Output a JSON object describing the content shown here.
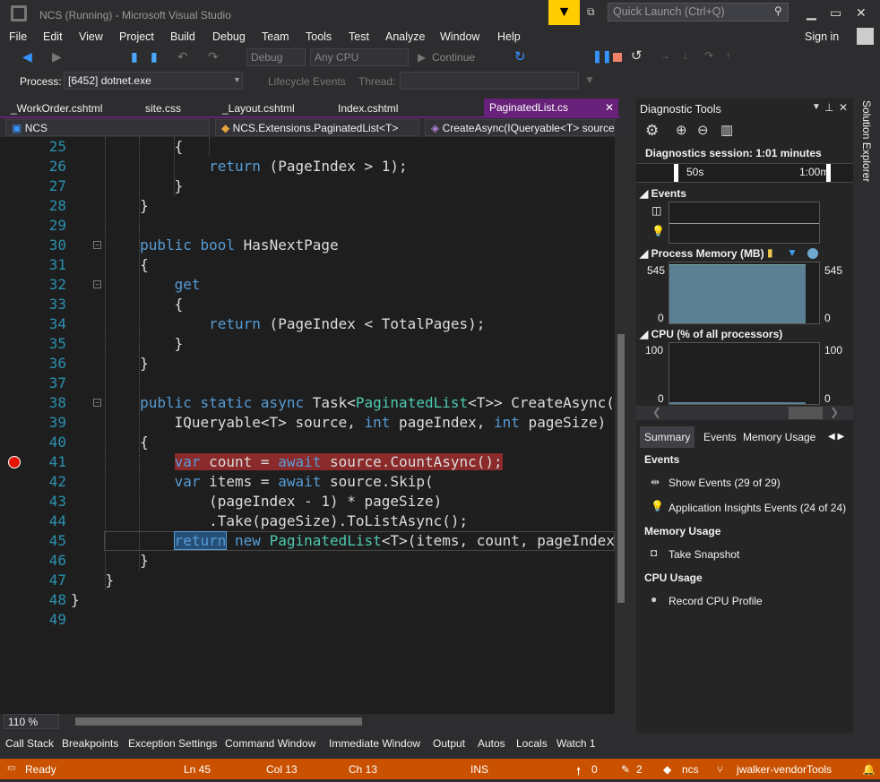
{
  "title": "NCS (Running) - Microsoft Visual Studio",
  "quick_launch": "Quick Launch (Ctrl+Q)",
  "menu": [
    "File",
    "Edit",
    "View",
    "Project",
    "Build",
    "Debug",
    "Team",
    "Tools",
    "Test",
    "Analyze",
    "Window",
    "Help"
  ],
  "sign_in": "Sign in",
  "toolbar": {
    "config": "Debug",
    "platform": "Any CPU",
    "continue": "Continue"
  },
  "process": {
    "label": "Process:",
    "value": "[6452] dotnet.exe",
    "lifecycle": "Lifecycle Events",
    "thread": "Thread:"
  },
  "tabs": [
    "_WorkOrder.cshtml",
    "site.css",
    "_Layout.cshtml",
    "Index.cshtml",
    "PaginatedList.cs"
  ],
  "nav": {
    "project": "NCS",
    "type": "NCS.Extensions.PaginatedList<T>",
    "member": "CreateAsync(IQueryable<T> source,"
  },
  "code": [
    {
      "n": "25",
      "t": [
        [
          "            {",
          ""
        ]
      ]
    },
    {
      "n": "26",
      "t": [
        [
          "                ",
          ""
        ],
        [
          "return",
          "kw"
        ],
        [
          " (PageIndex > 1);",
          ""
        ]
      ]
    },
    {
      "n": "27",
      "t": [
        [
          "            }",
          ""
        ]
      ]
    },
    {
      "n": "28",
      "t": [
        [
          "        }",
          ""
        ]
      ]
    },
    {
      "n": "29",
      "t": [
        [
          "",
          ""
        ]
      ]
    },
    {
      "n": "30",
      "t": [
        [
          "        ",
          ""
        ],
        [
          "public bool",
          "kw"
        ],
        [
          " HasNextPage",
          ""
        ]
      ]
    },
    {
      "n": "31",
      "t": [
        [
          "        {",
          ""
        ]
      ]
    },
    {
      "n": "32",
      "t": [
        [
          "            ",
          ""
        ],
        [
          "get",
          "kw"
        ]
      ]
    },
    {
      "n": "33",
      "t": [
        [
          "            {",
          ""
        ]
      ]
    },
    {
      "n": "34",
      "t": [
        [
          "                ",
          ""
        ],
        [
          "return",
          "kw"
        ],
        [
          " (PageIndex < TotalPages);",
          ""
        ]
      ]
    },
    {
      "n": "35",
      "t": [
        [
          "            }",
          ""
        ]
      ]
    },
    {
      "n": "36",
      "t": [
        [
          "        }",
          ""
        ]
      ]
    },
    {
      "n": "37",
      "t": [
        [
          "",
          ""
        ]
      ]
    },
    {
      "n": "38",
      "t": [
        [
          "        ",
          ""
        ],
        [
          "public static async",
          "kw"
        ],
        [
          " Task<",
          ""
        ],
        [
          "PaginatedList",
          "ty"
        ],
        [
          "<T>> CreateAsync(",
          ""
        ]
      ]
    },
    {
      "n": "39",
      "t": [
        [
          "            IQueryable<T> source, ",
          ""
        ],
        [
          "int",
          "kw"
        ],
        [
          " pageIndex, ",
          ""
        ],
        [
          "int",
          "kw"
        ],
        [
          " pageSize)",
          ""
        ]
      ]
    },
    {
      "n": "40",
      "t": [
        [
          "        {",
          ""
        ]
      ]
    },
    {
      "n": "41",
      "t": [
        [
          "            ",
          ""
        ],
        [
          "var",
          "kw hl-red"
        ],
        [
          " count = ",
          "hl-red"
        ],
        [
          "await",
          "kw hl-red"
        ],
        [
          " source.CountAsync();",
          "hl-red"
        ]
      ]
    },
    {
      "n": "42",
      "t": [
        [
          "            ",
          ""
        ],
        [
          "var",
          "kw"
        ],
        [
          " items = ",
          ""
        ],
        [
          "await",
          "kw"
        ],
        [
          " source.Skip(",
          ""
        ]
      ]
    },
    {
      "n": "43",
      "t": [
        [
          "                (pageIndex - 1) * pageSize)",
          ""
        ]
      ]
    },
    {
      "n": "44",
      "t": [
        [
          "                .Take(pageSize).ToListAsync();",
          ""
        ]
      ]
    },
    {
      "n": "45",
      "t": [
        [
          "            ",
          ""
        ],
        [
          "return",
          "kw sel"
        ],
        [
          " ",
          ""
        ],
        [
          "new",
          "kw"
        ],
        [
          " ",
          ""
        ],
        [
          "PaginatedList",
          "ty"
        ],
        [
          "<T>(items, count, pageIndex, pageSize);",
          ""
        ]
      ]
    },
    {
      "n": "46",
      "t": [
        [
          "        }",
          ""
        ]
      ]
    },
    {
      "n": "47",
      "t": [
        [
          "    }",
          ""
        ]
      ]
    },
    {
      "n": "48",
      "t": [
        [
          "}",
          ""
        ]
      ]
    },
    {
      "n": "49",
      "t": [
        [
          "",
          ""
        ]
      ]
    }
  ],
  "zoom": "110 %",
  "bottom_tabs": [
    "Call Stack",
    "Breakpoints",
    "Exception Settings",
    "Command Window",
    "Immediate Window",
    "Output",
    "Autos",
    "Locals",
    "Watch 1"
  ],
  "status": {
    "ready": "Ready",
    "ln": "Ln 45",
    "col": "Col 13",
    "ch": "Ch 13",
    "ins": "INS",
    "up": "0",
    "pencil": "2",
    "repo": "ncs",
    "branch": "jwalker-vendorTools"
  },
  "diag": {
    "title": "Diagnostic Tools",
    "session": "Diagnostics session: 1:01 minutes",
    "ruler": [
      "50s",
      "1:00m"
    ],
    "events": "Events",
    "memory": "Process Memory (MB)",
    "mem_max": "545",
    "mem_min": "0",
    "mem_value_fraction": 0.97,
    "cpu": "CPU (% of all processors)",
    "cpu_max": "100",
    "cpu_min": "0",
    "tabs": [
      "Summary",
      "Events",
      "Memory Usage"
    ],
    "summary": {
      "events_h": "Events",
      "show_events": "Show Events (29 of 29)",
      "ai_events": "Application Insights Events (24 of 24)",
      "mem_h": "Memory Usage",
      "snapshot": "Take Snapshot",
      "cpu_h": "CPU Usage",
      "record": "Record CPU Profile"
    }
  },
  "solution_explorer": "Solution Explorer",
  "colors": {
    "accent": "#68217a",
    "status": "#ca5100",
    "breakpoint": "#e51400"
  }
}
